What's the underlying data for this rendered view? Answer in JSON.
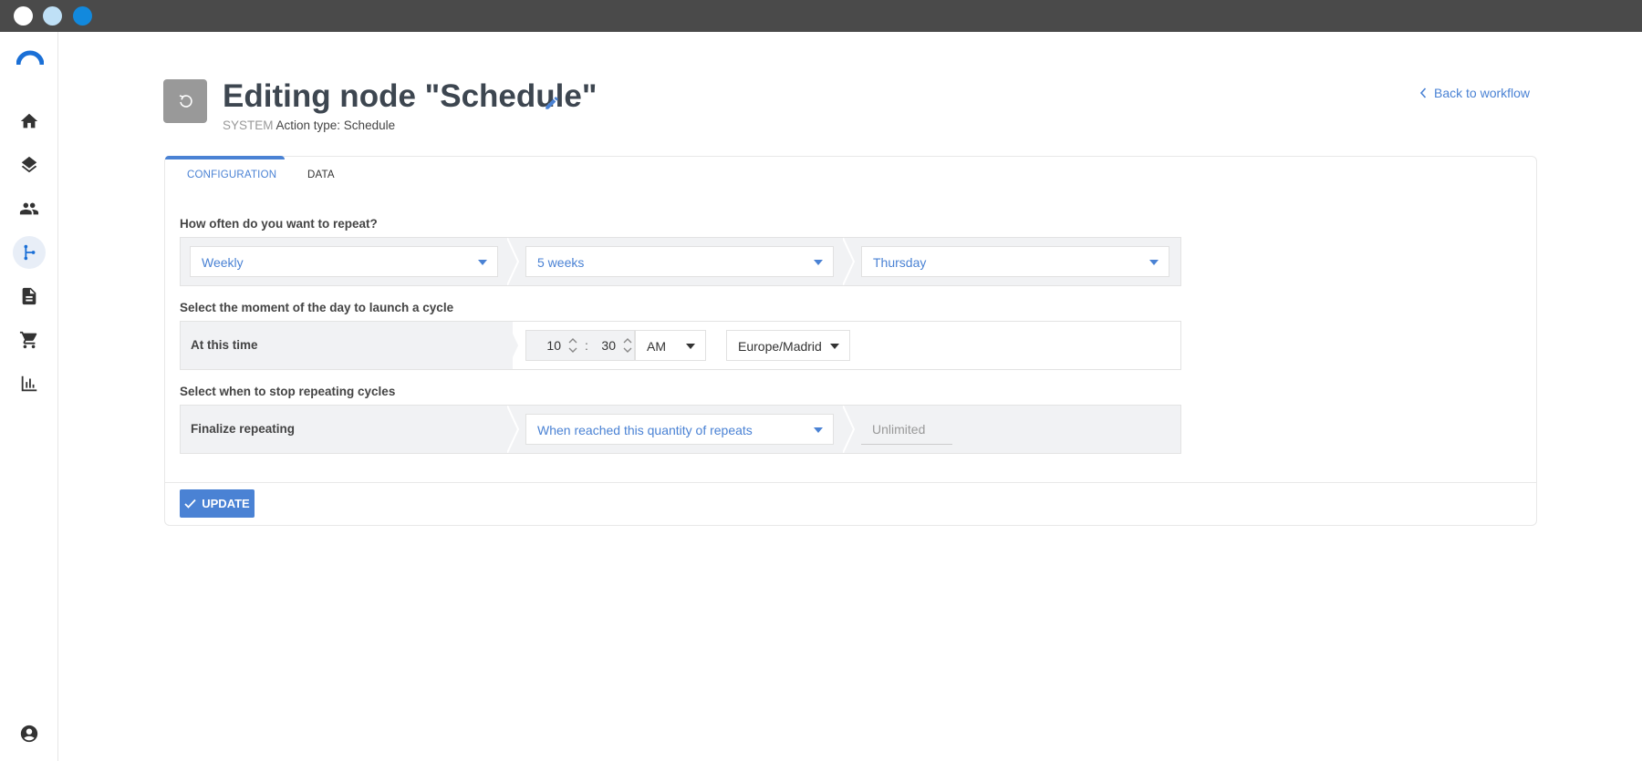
{
  "window": {
    "traffic_lights": [
      "close",
      "minimize",
      "maximize"
    ]
  },
  "sidebar": {
    "items": [
      {
        "name": "logo",
        "icon": "brand-logo"
      },
      {
        "name": "home",
        "icon": "home-icon"
      },
      {
        "name": "layers",
        "icon": "layers-icon"
      },
      {
        "name": "users",
        "icon": "people-icon"
      },
      {
        "name": "workflows",
        "icon": "workflow-branch-icon",
        "active": true
      },
      {
        "name": "documents",
        "icon": "document-icon"
      },
      {
        "name": "cart",
        "icon": "cart-icon"
      },
      {
        "name": "analytics",
        "icon": "bar-chart-icon"
      },
      {
        "name": "account",
        "icon": "account-circle-icon"
      }
    ]
  },
  "header": {
    "title": "Editing node \"Schedule\"",
    "subtitle_system": "SYSTEM",
    "subtitle_action": "Action type: Schedule",
    "back_link": "Back to workflow"
  },
  "tabs": [
    {
      "label": "CONFIGURATION",
      "active": true
    },
    {
      "label": "DATA",
      "active": false
    }
  ],
  "form": {
    "repeat": {
      "label": "How often do you want to repeat?",
      "frequency": "Weekly",
      "interval": "5 weeks",
      "weekday": "Thursday"
    },
    "moment": {
      "label": "Select the moment of the day to launch a cycle",
      "row_label": "At this time",
      "hour": "10",
      "separator": ":",
      "minute": "30",
      "period": "AM",
      "timezone": "Europe/Madrid"
    },
    "stop": {
      "label": "Select when to stop repeating cycles",
      "row_label": "Finalize repeating",
      "condition": "When reached this quantity of repeats",
      "quantity_placeholder": "Unlimited"
    }
  },
  "actions": {
    "update_label": "UPDATE"
  },
  "colors": {
    "accent": "#4a82d4",
    "titlebar": "#4a4a4a",
    "row_bg": "#f1f2f4",
    "badge": "#999999"
  }
}
